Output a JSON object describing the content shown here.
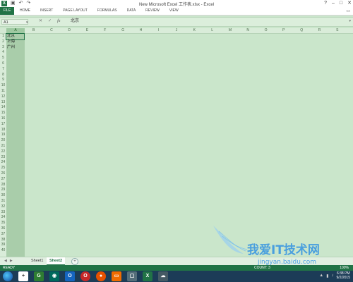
{
  "window": {
    "title": "New Microsoft Excel 工作表.xlsx - Excel",
    "controls": [
      "?",
      "–",
      "□",
      "✕"
    ]
  },
  "quick_access": [
    "↶",
    "↷"
  ],
  "ribbon": {
    "file": "FILE",
    "tabs": [
      "HOME",
      "INSERT",
      "PAGE LAYOUT",
      "FORMULAS",
      "DATA",
      "REVIEW",
      "VIEW"
    ]
  },
  "formula_bar": {
    "name_box": "A1",
    "content": "北京"
  },
  "columns": [
    "A",
    "B",
    "C",
    "D",
    "E",
    "F",
    "G",
    "H",
    "I",
    "J",
    "K",
    "L",
    "M",
    "N",
    "O",
    "P",
    "Q",
    "R",
    "S"
  ],
  "selected_column": "A",
  "rows": [
    "1",
    "2",
    "3",
    "4",
    "5",
    "6",
    "7",
    "8",
    "9",
    "10",
    "11",
    "12",
    "13",
    "14",
    "15",
    "16",
    "17",
    "18",
    "19",
    "20",
    "21",
    "22",
    "23",
    "24",
    "25",
    "26",
    "27",
    "28",
    "29",
    "30",
    "31",
    "32",
    "33",
    "34",
    "35",
    "36",
    "37",
    "38",
    "39",
    "40"
  ],
  "cells": [
    "北京",
    "上海",
    "广州"
  ],
  "sheet_tabs": [
    "Sheet1",
    "Sheet2"
  ],
  "active_sheet": "Sheet2",
  "status": {
    "ready": "READY",
    "count": "COUNT: 3",
    "zoom": "100%"
  },
  "taskbar": {
    "time": "6:38 PM",
    "date": "9/2/2015"
  },
  "watermark": {
    "text": "我爱IT技术网",
    "url": "jingyan.baidu.com"
  }
}
